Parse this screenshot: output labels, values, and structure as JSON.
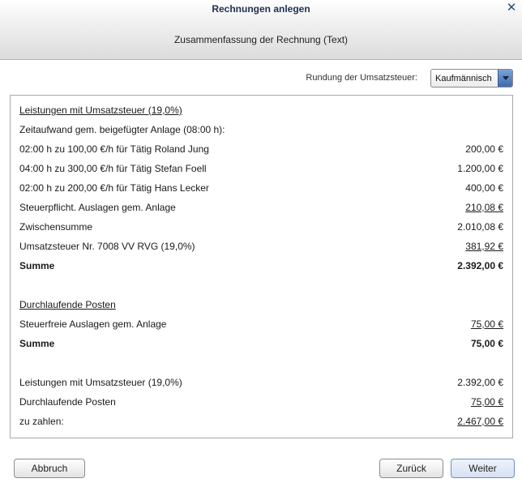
{
  "dialog": {
    "title": "Rechnungen anlegen",
    "subtitle": "Zusammenfassung der Rechnung (Text)",
    "close_icon": "close-icon"
  },
  "rounding": {
    "label": "Rundung der Umsatzsteuer:",
    "value": "Kaufmännisch"
  },
  "summary": {
    "section1_heading": "Leistungen mit Umsatzsteuer (19,0%)",
    "time_intro": "Zeitaufwand gem. beigefügter Anlage (08:00 h):",
    "time_lines": [
      {
        "label": "02:00 h zu 100,00 €/h für Tätig Roland Jung",
        "amount": "200,00 €"
      },
      {
        "label": "04:00 h zu 300,00 €/h für Tätig Stefan Foell",
        "amount": "1.200,00 €"
      },
      {
        "label": "02:00 h zu 200,00 €/h für Tätig Hans Lecker",
        "amount": "400,00 €"
      }
    ],
    "expenses_label": "Steuerpflicht. Auslagen gem. Anlage",
    "expenses_amount": "210,08 €",
    "subtotal_label": "Zwischensumme",
    "subtotal_amount": "2.010,08 €",
    "vat_label": "Umsatzsteuer Nr. 7008 VV RVG (19,0%)",
    "vat_amount": "381,92 €",
    "sum1_label": "Summe",
    "sum1_amount": "2.392,00 €",
    "section2_heading": "Durchlaufende Posten",
    "taxfree_label": "Steuerfreie Auslagen gem. Anlage",
    "taxfree_amount": "75,00 €",
    "sum2_label": "Summe",
    "sum2_amount": "75,00 €",
    "total_services_label": "Leistungen mit Umsatzsteuer (19,0%)",
    "total_services_amount": "2.392,00 €",
    "total_passthrough_label": "Durchlaufende Posten",
    "total_passthrough_amount": "75,00 €",
    "payable_label": "zu zahlen:",
    "payable_amount": "2.467,00 €"
  },
  "buttons": {
    "cancel": "Abbruch",
    "back": "Zurück",
    "next": "Weiter"
  },
  "colors": {
    "title_text": "#1e2f4f",
    "close_icon": "#2a4a86",
    "select_arrow": "#3d6bb0"
  }
}
